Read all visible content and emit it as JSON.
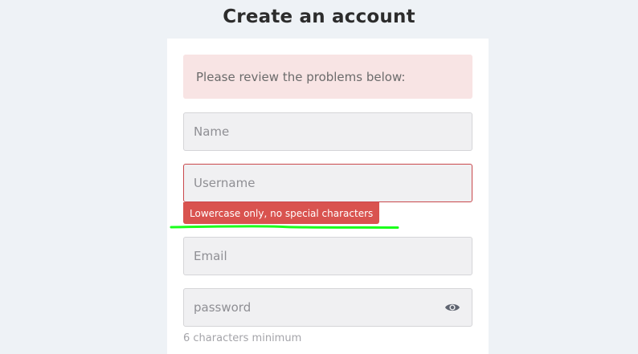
{
  "page": {
    "title": "Create an account"
  },
  "alert": {
    "text": "Please review the problems below:"
  },
  "form": {
    "name_placeholder": "Name",
    "username_placeholder": "Username",
    "username_error": "Lowercase only, no special characters",
    "email_placeholder": "Email",
    "password_placeholder": "password",
    "password_hint": "6 characters minimum"
  },
  "icons": {
    "password_toggle": "eye-icon"
  },
  "colors": {
    "error": "#d9534f",
    "alert_bg": "#f8e4e4",
    "annotation": "#1aff1a"
  }
}
